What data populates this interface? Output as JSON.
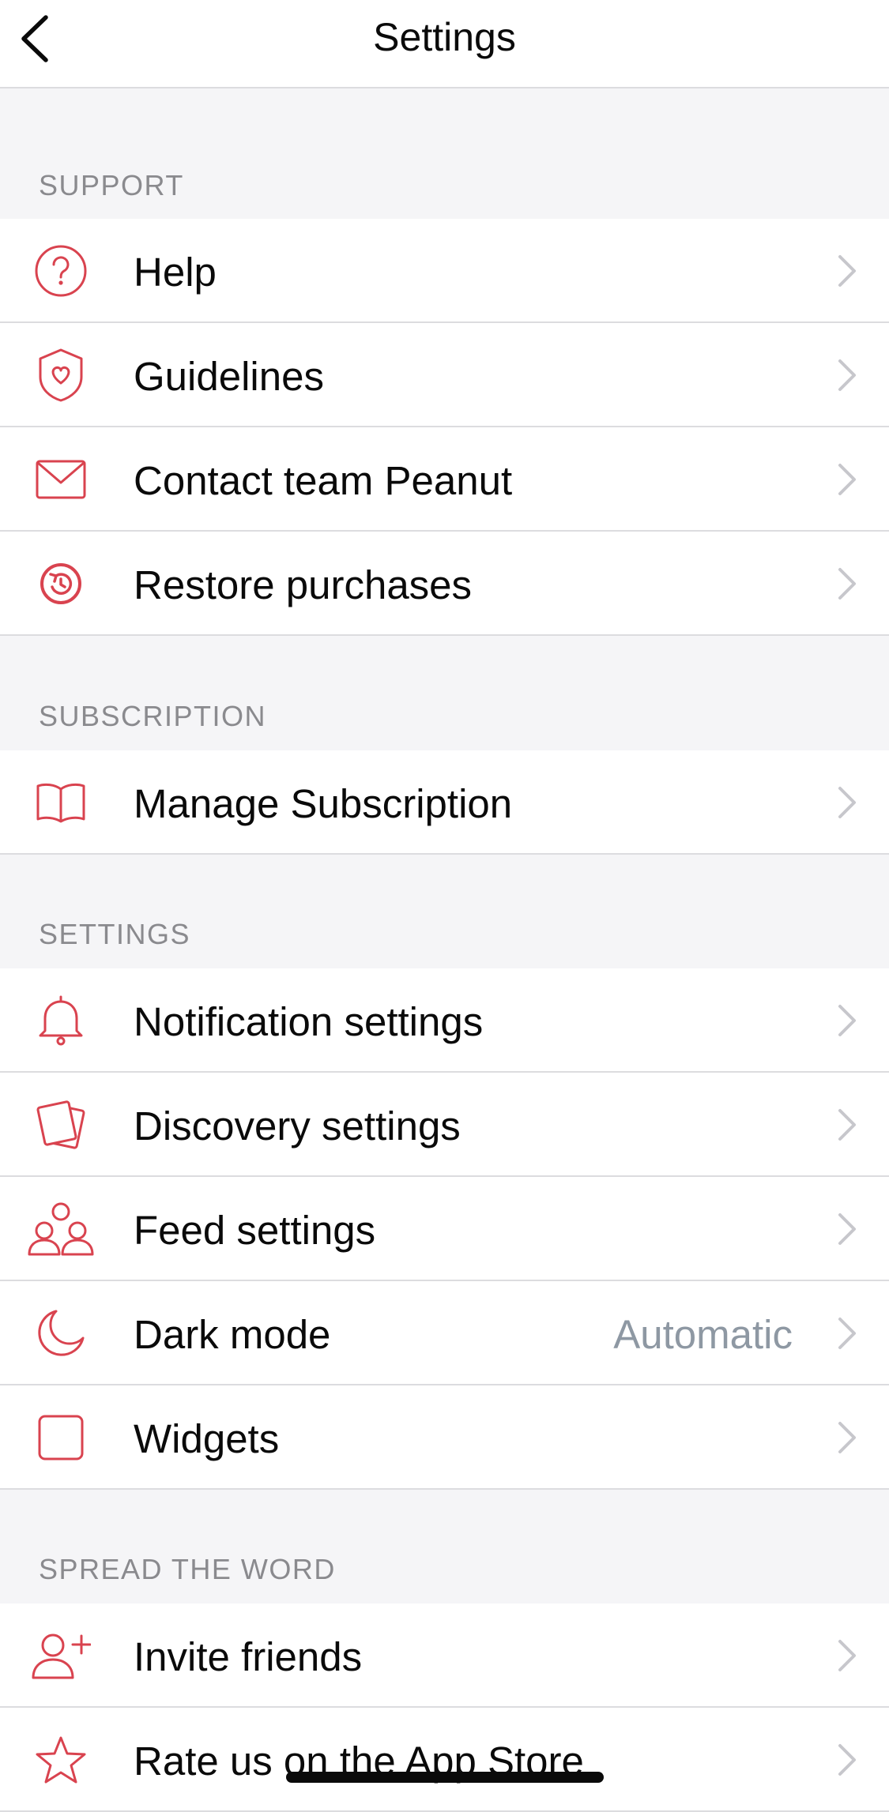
{
  "header": {
    "title": "Settings"
  },
  "colors": {
    "accent": "#d9434f",
    "chevron": "#c7c7cc",
    "value": "#8e98a3",
    "background": "#f5f5f7"
  },
  "sections": {
    "support": {
      "title": "SUPPORT",
      "items": [
        {
          "label": "Help",
          "icon": "help-icon"
        },
        {
          "label": "Guidelines",
          "icon": "shield-heart-icon"
        },
        {
          "label": "Contact team Peanut",
          "icon": "mail-icon"
        },
        {
          "label": "Restore purchases",
          "icon": "restore-icon"
        }
      ]
    },
    "subscription": {
      "title": "SUBSCRIPTION",
      "items": [
        {
          "label": "Manage Subscription",
          "icon": "book-icon"
        }
      ]
    },
    "settings": {
      "title": "SETTINGS",
      "items": [
        {
          "label": "Notification settings",
          "icon": "bell-icon"
        },
        {
          "label": "Discovery settings",
          "icon": "cards-icon"
        },
        {
          "label": "Feed settings",
          "icon": "group-icon"
        },
        {
          "label": "Dark mode",
          "value": "Automatic",
          "icon": "moon-icon"
        },
        {
          "label": "Widgets",
          "icon": "widget-icon"
        }
      ]
    },
    "spread": {
      "title": "SPREAD THE WORD",
      "items": [
        {
          "label": "Invite friends",
          "icon": "add-user-icon"
        },
        {
          "label": "Rate us on the App Store",
          "icon": "star-icon"
        }
      ]
    }
  }
}
